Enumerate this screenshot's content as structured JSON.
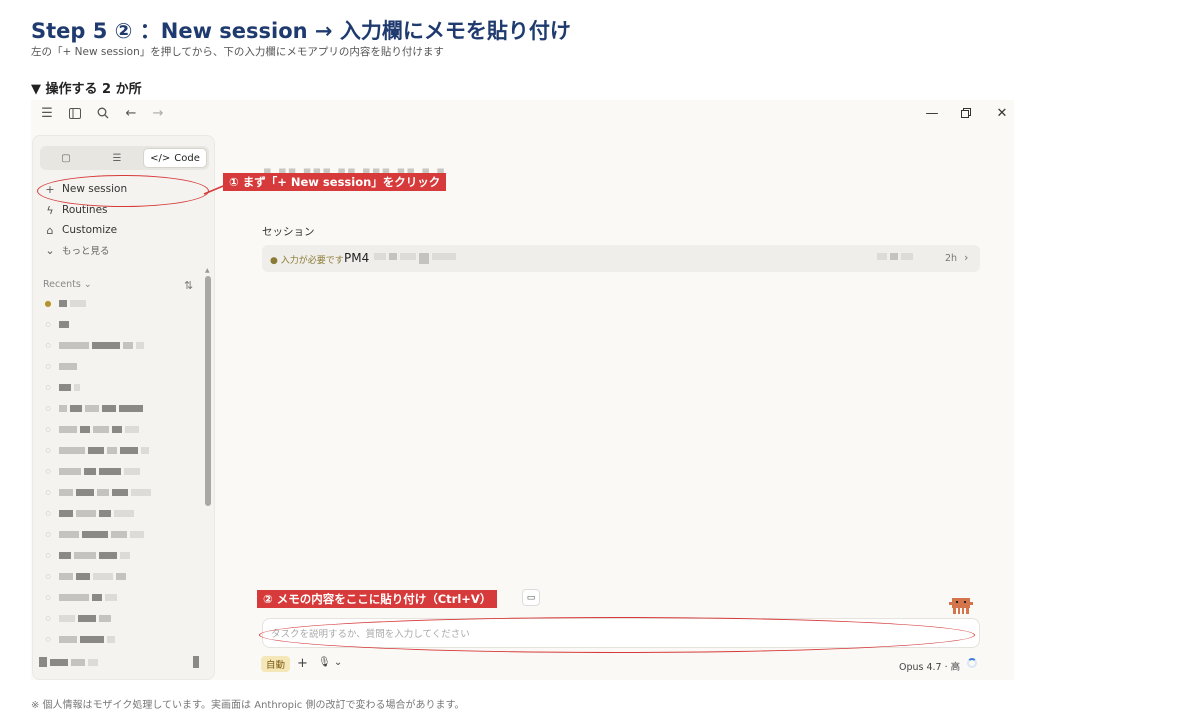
{
  "header": {
    "title": "Step 5 ② ：New session → 入力欄にメモを貼り付け",
    "subtitle": "左の「+ New session」を押してから、下の入力欄にメモアプリの内容を貼り付けます",
    "section": "▼ 操作する 2 か所"
  },
  "footnote": "※ 個人情報はモザイク処理しています。実画面は Anthropic 側の改訂で変わる場合があります。",
  "colors": {
    "accent": "#d63a3a",
    "title": "#1f3a6e",
    "badge": "#f6e7b8"
  },
  "topbar": {
    "icons": [
      "menu-icon",
      "sidebar-toggle-icon",
      "search-icon",
      "back-arrow-icon",
      "forward-arrow-icon"
    ],
    "window_controls": [
      "minimize-icon",
      "restore-icon",
      "close-icon"
    ]
  },
  "sidebar": {
    "mode_tabs": [
      {
        "icon": "chat-icon",
        "label": ""
      },
      {
        "icon": "tasks-icon",
        "label": ""
      },
      {
        "icon": "code-icon",
        "label": "Code"
      }
    ],
    "nav": [
      {
        "icon": "plus-icon",
        "label": "New session"
      },
      {
        "icon": "routines-icon",
        "label": "Routines"
      },
      {
        "icon": "briefcase-icon",
        "label": "Customize"
      },
      {
        "icon": "chevron-down-icon",
        "label": "もっと見る"
      }
    ],
    "recents_label": "Recents ⌄"
  },
  "main": {
    "sessions_label": "セッション",
    "session": {
      "status": "● 入力が必要です",
      "name": "PM4",
      "time": "2h"
    },
    "composer_placeholder": "タスクを説明するか、質問を入力してください",
    "auto_label": "自動",
    "model": "Opus 4.7 · 高"
  },
  "annotations": {
    "step1": "① まず「+ New session」をクリック",
    "step2": "② メモの内容をここに貼り付け（Ctrl+V）"
  }
}
